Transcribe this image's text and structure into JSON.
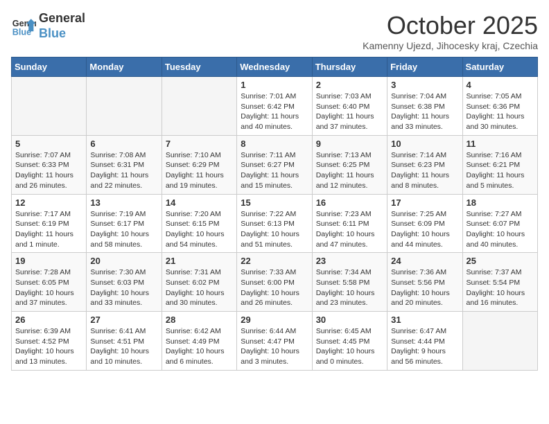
{
  "header": {
    "logo_line1": "General",
    "logo_line2": "Blue",
    "month_title": "October 2025",
    "subtitle": "Kamenny Ujezd, Jihocesky kraj, Czechia"
  },
  "weekdays": [
    "Sunday",
    "Monday",
    "Tuesday",
    "Wednesday",
    "Thursday",
    "Friday",
    "Saturday"
  ],
  "weeks": [
    [
      {
        "day": "",
        "info": ""
      },
      {
        "day": "",
        "info": ""
      },
      {
        "day": "",
        "info": ""
      },
      {
        "day": "1",
        "info": "Sunrise: 7:01 AM\nSunset: 6:42 PM\nDaylight: 11 hours\nand 40 minutes."
      },
      {
        "day": "2",
        "info": "Sunrise: 7:03 AM\nSunset: 6:40 PM\nDaylight: 11 hours\nand 37 minutes."
      },
      {
        "day": "3",
        "info": "Sunrise: 7:04 AM\nSunset: 6:38 PM\nDaylight: 11 hours\nand 33 minutes."
      },
      {
        "day": "4",
        "info": "Sunrise: 7:05 AM\nSunset: 6:36 PM\nDaylight: 11 hours\nand 30 minutes."
      }
    ],
    [
      {
        "day": "5",
        "info": "Sunrise: 7:07 AM\nSunset: 6:33 PM\nDaylight: 11 hours\nand 26 minutes."
      },
      {
        "day": "6",
        "info": "Sunrise: 7:08 AM\nSunset: 6:31 PM\nDaylight: 11 hours\nand 22 minutes."
      },
      {
        "day": "7",
        "info": "Sunrise: 7:10 AM\nSunset: 6:29 PM\nDaylight: 11 hours\nand 19 minutes."
      },
      {
        "day": "8",
        "info": "Sunrise: 7:11 AM\nSunset: 6:27 PM\nDaylight: 11 hours\nand 15 minutes."
      },
      {
        "day": "9",
        "info": "Sunrise: 7:13 AM\nSunset: 6:25 PM\nDaylight: 11 hours\nand 12 minutes."
      },
      {
        "day": "10",
        "info": "Sunrise: 7:14 AM\nSunset: 6:23 PM\nDaylight: 11 hours\nand 8 minutes."
      },
      {
        "day": "11",
        "info": "Sunrise: 7:16 AM\nSunset: 6:21 PM\nDaylight: 11 hours\nand 5 minutes."
      }
    ],
    [
      {
        "day": "12",
        "info": "Sunrise: 7:17 AM\nSunset: 6:19 PM\nDaylight: 11 hours\nand 1 minute."
      },
      {
        "day": "13",
        "info": "Sunrise: 7:19 AM\nSunset: 6:17 PM\nDaylight: 10 hours\nand 58 minutes."
      },
      {
        "day": "14",
        "info": "Sunrise: 7:20 AM\nSunset: 6:15 PM\nDaylight: 10 hours\nand 54 minutes."
      },
      {
        "day": "15",
        "info": "Sunrise: 7:22 AM\nSunset: 6:13 PM\nDaylight: 10 hours\nand 51 minutes."
      },
      {
        "day": "16",
        "info": "Sunrise: 7:23 AM\nSunset: 6:11 PM\nDaylight: 10 hours\nand 47 minutes."
      },
      {
        "day": "17",
        "info": "Sunrise: 7:25 AM\nSunset: 6:09 PM\nDaylight: 10 hours\nand 44 minutes."
      },
      {
        "day": "18",
        "info": "Sunrise: 7:27 AM\nSunset: 6:07 PM\nDaylight: 10 hours\nand 40 minutes."
      }
    ],
    [
      {
        "day": "19",
        "info": "Sunrise: 7:28 AM\nSunset: 6:05 PM\nDaylight: 10 hours\nand 37 minutes."
      },
      {
        "day": "20",
        "info": "Sunrise: 7:30 AM\nSunset: 6:03 PM\nDaylight: 10 hours\nand 33 minutes."
      },
      {
        "day": "21",
        "info": "Sunrise: 7:31 AM\nSunset: 6:02 PM\nDaylight: 10 hours\nand 30 minutes."
      },
      {
        "day": "22",
        "info": "Sunrise: 7:33 AM\nSunset: 6:00 PM\nDaylight: 10 hours\nand 26 minutes."
      },
      {
        "day": "23",
        "info": "Sunrise: 7:34 AM\nSunset: 5:58 PM\nDaylight: 10 hours\nand 23 minutes."
      },
      {
        "day": "24",
        "info": "Sunrise: 7:36 AM\nSunset: 5:56 PM\nDaylight: 10 hours\nand 20 minutes."
      },
      {
        "day": "25",
        "info": "Sunrise: 7:37 AM\nSunset: 5:54 PM\nDaylight: 10 hours\nand 16 minutes."
      }
    ],
    [
      {
        "day": "26",
        "info": "Sunrise: 6:39 AM\nSunset: 4:52 PM\nDaylight: 10 hours\nand 13 minutes."
      },
      {
        "day": "27",
        "info": "Sunrise: 6:41 AM\nSunset: 4:51 PM\nDaylight: 10 hours\nand 10 minutes."
      },
      {
        "day": "28",
        "info": "Sunrise: 6:42 AM\nSunset: 4:49 PM\nDaylight: 10 hours\nand 6 minutes."
      },
      {
        "day": "29",
        "info": "Sunrise: 6:44 AM\nSunset: 4:47 PM\nDaylight: 10 hours\nand 3 minutes."
      },
      {
        "day": "30",
        "info": "Sunrise: 6:45 AM\nSunset: 4:45 PM\nDaylight: 10 hours\nand 0 minutes."
      },
      {
        "day": "31",
        "info": "Sunrise: 6:47 AM\nSunset: 4:44 PM\nDaylight: 9 hours\nand 56 minutes."
      },
      {
        "day": "",
        "info": ""
      }
    ]
  ]
}
